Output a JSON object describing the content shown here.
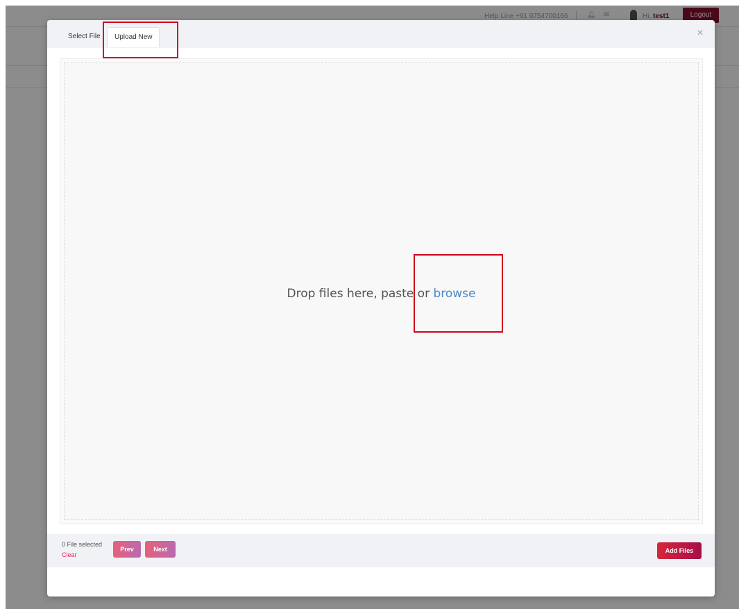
{
  "topbar": {
    "helpline": "Help Line +91 9754700166",
    "greeting_prefix": "Hi,",
    "username": "test1",
    "logout_label": "Logout",
    "bell_icon": "bell-icon",
    "mail_icon": "mail-icon"
  },
  "modal": {
    "tabs": [
      {
        "label": "Select File"
      },
      {
        "label": "Upload New"
      }
    ],
    "close_icon": "×",
    "dropzone": {
      "text_before": "Drop files here, paste or ",
      "browse_label": "browse"
    },
    "footer": {
      "selected_count": "0 File selected",
      "clear_label": "Clear",
      "prev_label": "Prev",
      "next_label": "Next",
      "add_files_label": "Add Files"
    }
  },
  "colors": {
    "logout_bg": "#8b1032",
    "browse_link": "#4a88c7",
    "annotation_red": "#d0021b",
    "add_files_bg": "#c8183f"
  }
}
